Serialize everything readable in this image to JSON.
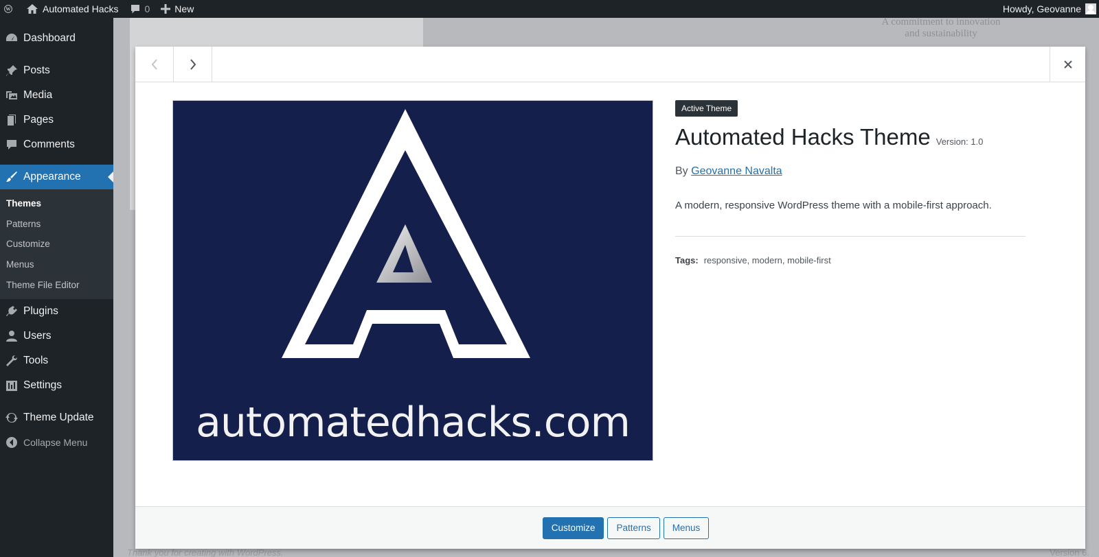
{
  "adminbar": {
    "site_name": "Automated Hacks",
    "comments_count": "0",
    "new_label": "New",
    "howdy": "Howdy, Geovanne"
  },
  "sidebar": {
    "items": [
      {
        "label": "Dashboard",
        "icon": "dashboard-icon"
      },
      {
        "label": "Posts",
        "icon": "pin-icon"
      },
      {
        "label": "Media",
        "icon": "media-icon"
      },
      {
        "label": "Pages",
        "icon": "pages-icon"
      },
      {
        "label": "Comments",
        "icon": "comment-icon"
      },
      {
        "label": "Appearance",
        "icon": "brush-icon"
      },
      {
        "label": "Plugins",
        "icon": "plugin-icon"
      },
      {
        "label": "Users",
        "icon": "user-icon"
      },
      {
        "label": "Tools",
        "icon": "wrench-icon"
      },
      {
        "label": "Settings",
        "icon": "settings-icon"
      },
      {
        "label": "Theme Update",
        "icon": "update-icon"
      },
      {
        "label": "Collapse Menu",
        "icon": "collapse-icon"
      }
    ],
    "submenu": [
      "Themes",
      "Patterns",
      "Customize",
      "Menus",
      "Theme File Editor"
    ]
  },
  "background": {
    "footer_text": "Thank you for creating with WordPress.",
    "version": "Version 6.",
    "quote": "A commitment to innovation and sustainability"
  },
  "theme": {
    "badge": "Active Theme",
    "name": "Automated Hacks Theme",
    "version": "Version: 1.0",
    "by_label": "By",
    "author": "Geovanne Navalta",
    "description": "A modern, responsive WordPress theme with a mobile-first approach.",
    "tags_label": "Tags:",
    "tags": "responsive, modern, mobile-first",
    "screenshot_text": "automatedhacks.com"
  },
  "footer": {
    "customize": "Customize",
    "patterns": "Patterns",
    "menus": "Menus"
  },
  "colors": {
    "admin_dark": "#1d2327",
    "accent": "#2271b1",
    "screenshot_bg": "#14204b"
  }
}
